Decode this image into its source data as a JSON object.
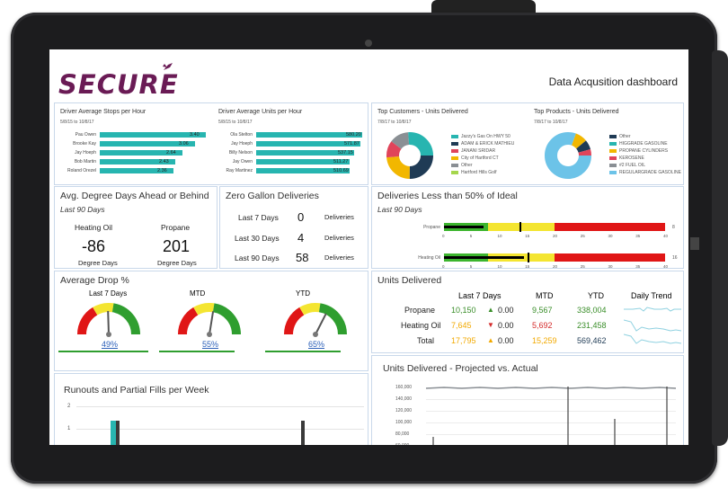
{
  "header": {
    "logo_text": "SECURE",
    "title": "Data Acqusition dashboard"
  },
  "stops": {
    "title": "Driver Average Stops per Hour",
    "date": "5/8/15 to 10/8/17",
    "rows": [
      {
        "name": "Pau Owen",
        "value": 3.4
      },
      {
        "name": "Brooke Kay",
        "value": 3.06
      },
      {
        "name": "Jay Hoeph",
        "value": 2.64
      },
      {
        "name": "Bob Martin",
        "value": 2.43
      },
      {
        "name": "Roland Orezel",
        "value": 2.36
      }
    ]
  },
  "units": {
    "title": "Driver Average Units per Hour",
    "date": "5/8/15 to 10/8/17",
    "rows": [
      {
        "name": "Ola Stelton",
        "value": 580.2
      },
      {
        "name": "Jay Hoeph",
        "value": 571.87
      },
      {
        "name": "Billy Nelson",
        "value": 537.15
      },
      {
        "name": "Jay Owen",
        "value": 511.27
      },
      {
        "name": "Ray Martinez",
        "value": 510.69
      }
    ]
  },
  "top_customers": {
    "title": "Top Customers - Units Delivered",
    "date": "7/8/17 to 10/8/17",
    "legend": [
      "Jazzy's Gas On HWY 50",
      "ADAM & ERICK MATHIEU",
      "JANANI SRIDAR",
      "City of Hartford CT",
      "Other",
      "Hartford Hills Golf"
    ]
  },
  "top_products": {
    "title": "Top Products - Units Delivered",
    "date": "7/8/17 to 10/8/17",
    "legend": [
      "Other",
      "HIGGRADE GASOLINE",
      "PROPANE CYLINDERS",
      "KEROSENE",
      "#2 FUEL OIL",
      "REGULARGRADE GASOLINE"
    ]
  },
  "degree_days": {
    "title": "Avg. Degree Days Ahead or Behind",
    "period": "Last 90 Days",
    "cols": [
      {
        "label": "Heating Oil",
        "value": "-86",
        "unit": "Degree Days"
      },
      {
        "label": "Propane",
        "value": "201",
        "unit": "Degree Days"
      }
    ]
  },
  "zero_gallon": {
    "title": "Zero Gallon Deliveries",
    "rows": [
      {
        "label": "Last 7 Days",
        "value": "0",
        "unit": "Deliveries"
      },
      {
        "label": "Last 30 Days",
        "value": "4",
        "unit": "Deliveries"
      },
      {
        "label": "Last 90 Days",
        "value": "58",
        "unit": "Deliveries"
      }
    ]
  },
  "less_than": {
    "title": "Deliveries Less than 50% of Ideal",
    "period": "Last 90 Days",
    "rows": [
      {
        "label": "Propane",
        "value": "8",
        "fill": 0.18,
        "marker": 0.34
      },
      {
        "label": "Heating Oil",
        "value": "16",
        "fill": 0.36,
        "marker": 0.38
      }
    ],
    "ticks": [
      "0",
      "5",
      "10",
      "15",
      "20",
      "25",
      "30",
      "35",
      "40"
    ]
  },
  "drop": {
    "title": "Average Drop %",
    "gauges": [
      {
        "label": "Last 7 Days",
        "value": "49%",
        "pct": 0.49
      },
      {
        "label": "MTD",
        "value": "55%",
        "pct": 0.55
      },
      {
        "label": "YTD",
        "value": "65%",
        "pct": 0.65
      }
    ]
  },
  "units_delivered": {
    "title": "Units Delivered",
    "headers": [
      "Last 7 Days",
      "MTD",
      "YTD",
      "Daily Trend"
    ],
    "rows": [
      {
        "label": "Propane",
        "last7": "10,150",
        "last7_color": "#3a8e2a",
        "arrow": "▲",
        "arrow_color": "#3a8e2a",
        "change": "0.00",
        "mtd": "9,567",
        "mtd_color": "#3a8e2a",
        "ytd": "338,004",
        "ytd_color": "#3a8e2a"
      },
      {
        "label": "Heating Oil",
        "last7": "7,645",
        "last7_color": "#f2a900",
        "arrow": "▼",
        "arrow_color": "#d42a2a",
        "change": "0.00",
        "mtd": "5,692",
        "mtd_color": "#d42a2a",
        "ytd": "231,458",
        "ytd_color": "#3a8e2a"
      },
      {
        "label": "Total",
        "last7": "17,795",
        "last7_color": "#f2a900",
        "arrow": "▲",
        "arrow_color": "#f2a900",
        "change": "0.00",
        "mtd": "15,259",
        "mtd_color": "#f2a900",
        "ytd": "569,462",
        "ytd_color": "#1f3b55"
      }
    ]
  },
  "runouts": {
    "title": "Runouts and Partial Fills per Week",
    "ticks": [
      "2",
      "1"
    ]
  },
  "projected": {
    "title": "Units Delivered - Projected vs. Actual",
    "ticks": [
      "160,000",
      "140,000",
      "120,000",
      "100,000",
      "80,000",
      "60,000",
      "40,000"
    ]
  },
  "colors": {
    "brand": "#6a1b55",
    "teal": "#27b5b0",
    "tile_border": "#c9d8ea"
  }
}
